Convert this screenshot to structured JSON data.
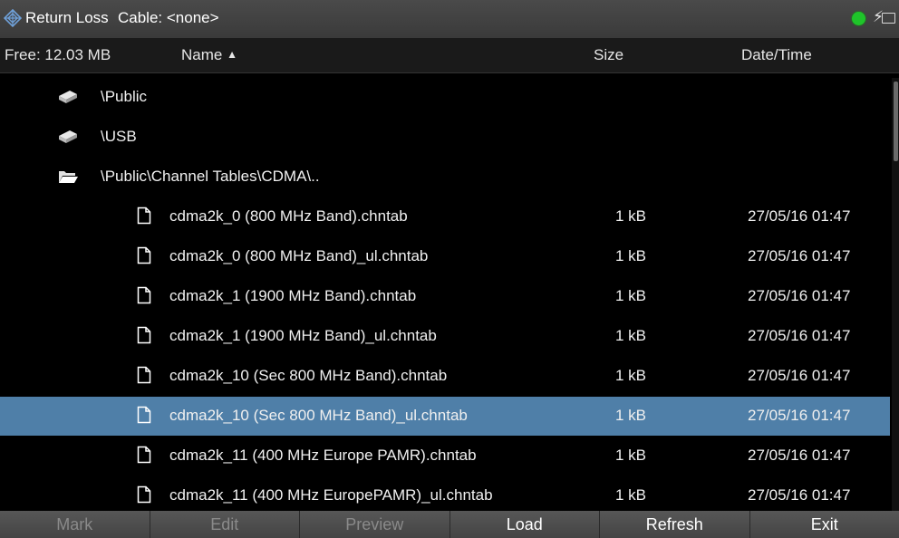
{
  "titlebar": {
    "mode": "Return Loss",
    "cable": "Cable: <none>"
  },
  "header": {
    "free": "Free: 12.03 MB",
    "name": "Name",
    "size": "Size",
    "datetime": "Date/Time"
  },
  "dirs": [
    {
      "label": "\\Public",
      "icon": "drive-icon"
    },
    {
      "label": "\\USB",
      "icon": "drive-icon"
    },
    {
      "label": "\\Public\\Channel Tables\\CDMA\\..",
      "icon": "folder-open-icon"
    }
  ],
  "files": [
    {
      "name": "cdma2k_0 (800 MHz Band).chntab",
      "size": "1 kB",
      "date": "27/05/16 01:47"
    },
    {
      "name": "cdma2k_0 (800 MHz Band)_ul.chntab",
      "size": "1 kB",
      "date": "27/05/16 01:47"
    },
    {
      "name": "cdma2k_1 (1900 MHz Band).chntab",
      "size": "1 kB",
      "date": "27/05/16 01:47"
    },
    {
      "name": "cdma2k_1 (1900 MHz Band)_ul.chntab",
      "size": "1 kB",
      "date": "27/05/16 01:47"
    },
    {
      "name": "cdma2k_10 (Sec 800 MHz Band).chntab",
      "size": "1 kB",
      "date": "27/05/16 01:47"
    },
    {
      "name": "cdma2k_10 (Sec 800 MHz Band)_ul.chntab",
      "size": "1 kB",
      "date": "27/05/16 01:47"
    },
    {
      "name": "cdma2k_11 (400 MHz Europe PAMR).chntab",
      "size": "1 kB",
      "date": "27/05/16 01:47"
    },
    {
      "name": "cdma2k_11 (400 MHz EuropePAMR)_ul.chntab",
      "size": "1 kB",
      "date": "27/05/16 01:47"
    }
  ],
  "selected_index": 5,
  "softkeys": [
    {
      "label": "Mark",
      "enabled": true
    },
    {
      "label": "Edit",
      "enabled": false
    },
    {
      "label": "Preview",
      "enabled": false
    },
    {
      "label": "Load",
      "enabled": true
    },
    {
      "label": "Refresh",
      "enabled": true
    },
    {
      "label": "Exit",
      "enabled": true
    }
  ],
  "colors": {
    "selection": "#4f7fa8",
    "status_led": "#1fc42a"
  }
}
